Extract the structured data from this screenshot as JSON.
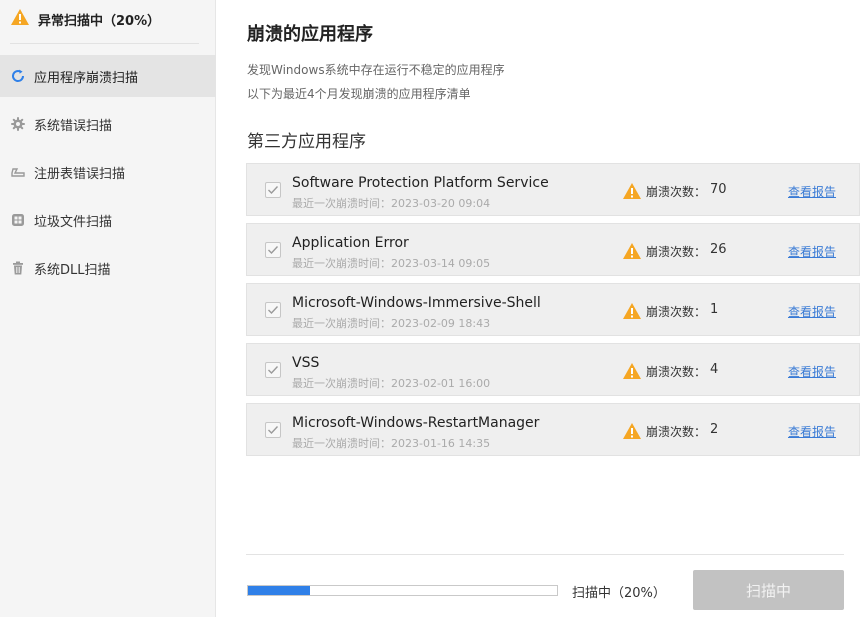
{
  "sidebar": {
    "status_text": "异常扫描中（20%）",
    "items": [
      {
        "label": "应用程序崩溃扫描",
        "icon": "refresh-icon",
        "active": true
      },
      {
        "label": "系统错误扫描",
        "icon": "gear-icon",
        "active": false
      },
      {
        "label": "注册表错误扫描",
        "icon": "registry-icon",
        "active": false
      },
      {
        "label": "垃圾文件扫描",
        "icon": "junk-icon",
        "active": false
      },
      {
        "label": "系统DLL扫描",
        "icon": "trash-icon",
        "active": false
      }
    ]
  },
  "main": {
    "title": "崩溃的应用程序",
    "desc1": "发现Windows系统中存在运行不稳定的应用程序",
    "desc2": "以下为最近4个月发现崩溃的应用程序清单",
    "section_title": "第三方应用程序",
    "crash_count_label": "崩溃次数：",
    "report_label": "查看报告",
    "apps": [
      {
        "name": "Software Protection Platform Service",
        "time": "最近一次崩溃时间：2023-03-20 09:04",
        "count": "70",
        "checked": true
      },
      {
        "name": "Application Error",
        "time": "最近一次崩溃时间：2023-03-14 09:05",
        "count": "26",
        "checked": true
      },
      {
        "name": "Microsoft-Windows-Immersive-Shell",
        "time": "最近一次崩溃时间：2023-02-09 18:43",
        "count": "1",
        "checked": true
      },
      {
        "name": "VSS",
        "time": "最近一次崩溃时间：2023-02-01 16:00",
        "count": "4",
        "checked": true
      },
      {
        "name": "Microsoft-Windows-RestartManager",
        "time": "最近一次崩溃时间：2023-01-16 14:35",
        "count": "2",
        "checked": true
      }
    ]
  },
  "footer": {
    "progress_percent": 20,
    "progress_text": "扫描中（20%）",
    "scan_button": "扫描中"
  },
  "colors": {
    "warning": "#f5a623",
    "accent": "#2f80e8",
    "link": "#3a7bd5"
  }
}
